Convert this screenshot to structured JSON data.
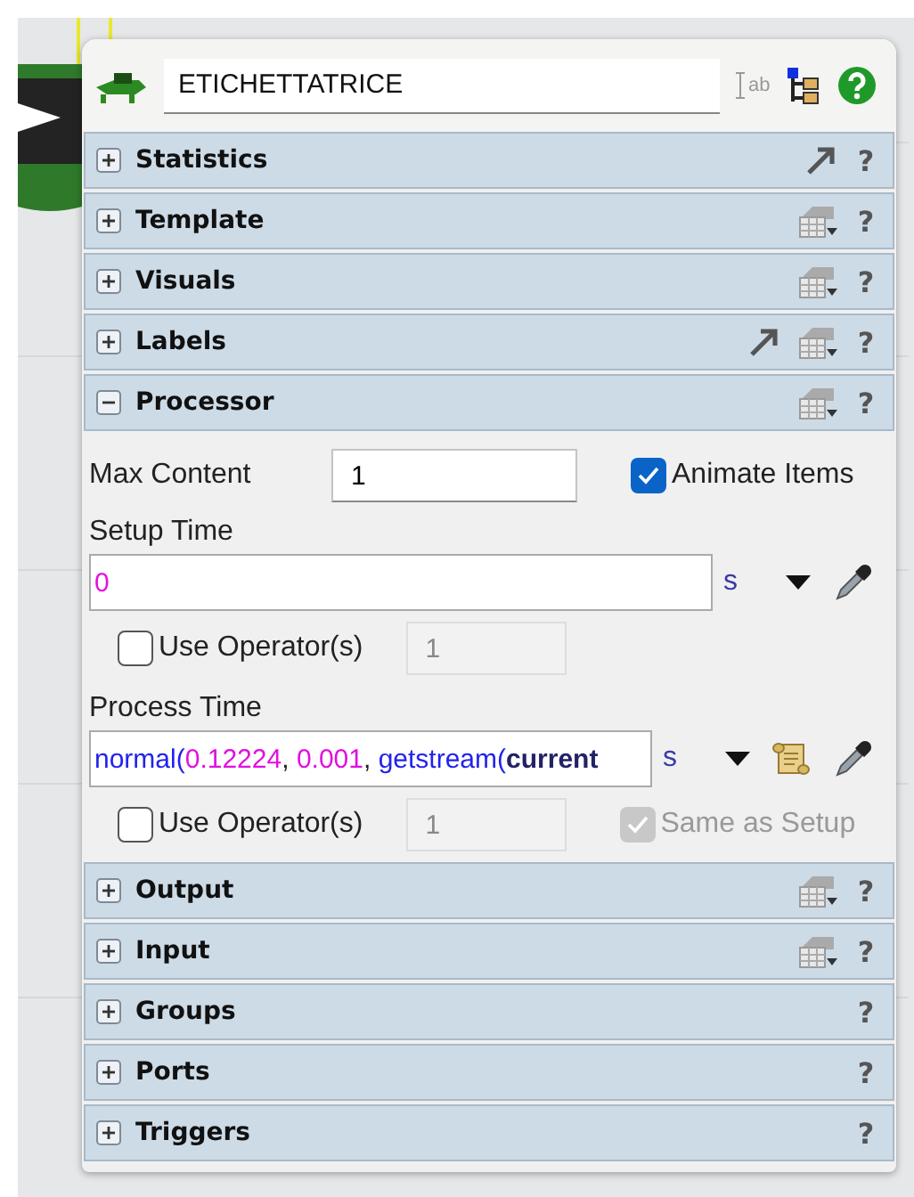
{
  "header": {
    "title": "ETICHETTATRICE",
    "label_tool": "ab"
  },
  "sections": [
    {
      "name": "Statistics",
      "expanded": false,
      "link_button": true,
      "help": "?"
    },
    {
      "name": "Template",
      "expanded": false,
      "menu_button": true,
      "help": "?"
    },
    {
      "name": "Visuals",
      "expanded": false,
      "menu_button": true,
      "help": "?"
    },
    {
      "name": "Labels",
      "expanded": false,
      "link_button": true,
      "menu_button": true,
      "help": "?"
    },
    {
      "name": "Processor",
      "expanded": true,
      "menu_button": true,
      "help": "?",
      "content": {
        "max_content": {
          "label": "Max Content",
          "value": "1"
        },
        "animate_items": {
          "label": "Animate Items",
          "checked": true
        },
        "setup_time": {
          "label": "Setup Time",
          "tokens": [
            {
              "text": "0",
              "kind": "number"
            }
          ],
          "unit": "s",
          "use_operators": {
            "label": "Use Operator(s)",
            "checked": false,
            "count": "1"
          }
        },
        "process_time": {
          "label": "Process Time",
          "tokens": [
            {
              "text": "normal(",
              "kind": "name"
            },
            {
              "text": "0.12224",
              "kind": "number"
            },
            {
              "text": ", ",
              "kind": "plain"
            },
            {
              "text": "0.001",
              "kind": "number"
            },
            {
              "text": ", ",
              "kind": "plain"
            },
            {
              "text": "getstream(",
              "kind": "name"
            },
            {
              "text": "current",
              "kind": "variable"
            }
          ],
          "unit": "s",
          "script_button": true,
          "use_operators": {
            "label": "Use Operator(s)",
            "checked": false,
            "count": "1"
          },
          "same_as_setup": {
            "label": "Same as Setup",
            "checked": true,
            "disabled": true
          }
        }
      }
    },
    {
      "name": "Output",
      "expanded": false,
      "menu_button": true,
      "help": "?"
    },
    {
      "name": "Input",
      "expanded": false,
      "menu_button": true,
      "help": "?"
    },
    {
      "name": "Groups",
      "expanded": false,
      "help": "?"
    },
    {
      "name": "Ports",
      "expanded": false,
      "help": "?"
    },
    {
      "name": "Triggers",
      "expanded": false,
      "help": "?"
    }
  ]
}
